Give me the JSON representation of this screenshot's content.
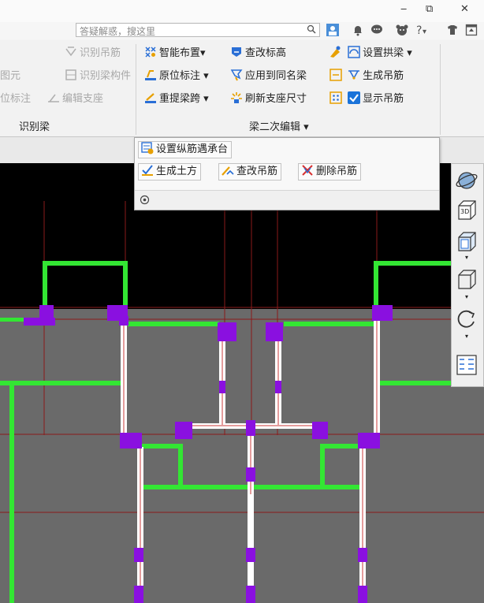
{
  "titlebar": {
    "min": "‒",
    "restore": "⧉",
    "close": "✕"
  },
  "search": {
    "placeholder": "答疑解惑，搜这里",
    "search_icon": "search-icon"
  },
  "top_icons": [
    "avatar-icon",
    "bell-icon",
    "chat-icon",
    "bear-icon",
    "help-icon",
    "shirt-icon",
    "window-icon"
  ],
  "ribbon": {
    "left_group": {
      "items": [
        "识别吊筋",
        "识别梁构件",
        "编辑支座"
      ],
      "cut_items": [
        "图元",
        "位标注"
      ],
      "label": "识别梁"
    },
    "right_group": {
      "col1": [
        "智能布置",
        "原位标注",
        "重提梁跨"
      ],
      "col2": [
        "查改标高",
        "应用到同名梁",
        "刷新支座尺寸"
      ],
      "col3": [
        "设置拱梁",
        "生成吊筋",
        "显示吊筋"
      ],
      "label": "梁二次编辑"
    }
  },
  "popup": {
    "row1": [
      "设置纵筋遇承台"
    ],
    "row2": [
      "生成土方",
      "查改吊筋",
      "删除吊筋"
    ]
  },
  "view_toolbar": {
    "cube_label": "3D"
  },
  "colors": {
    "green": "#33e633",
    "purple": "#8a10e0",
    "red_line": "#8a1a1a",
    "canvas": "#6a6a6a"
  }
}
